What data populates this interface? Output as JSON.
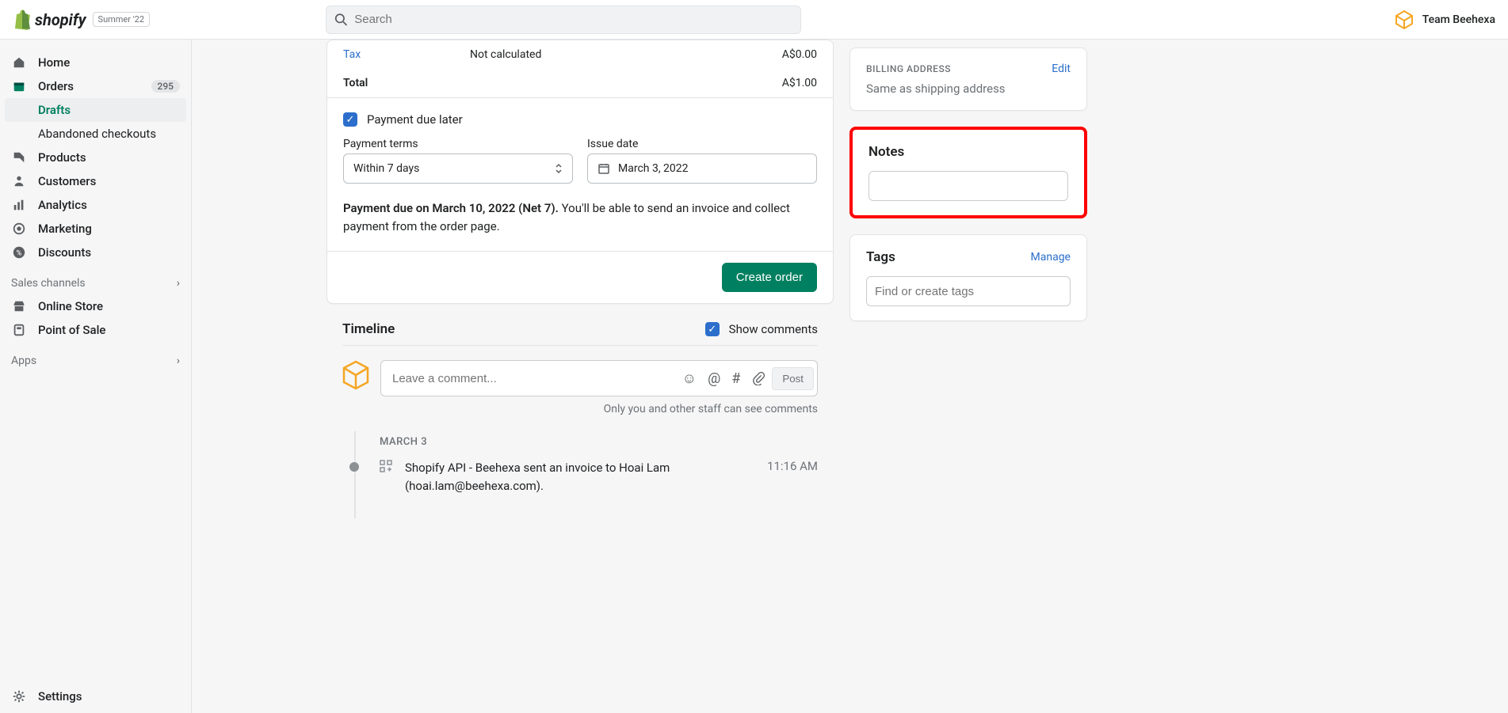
{
  "header": {
    "brand": "shopify",
    "badge": "Summer '22",
    "search_placeholder": "Search",
    "team": "Team Beehexa"
  },
  "sidebar": {
    "home": "Home",
    "orders": "Orders",
    "orders_count": "295",
    "drafts": "Drafts",
    "abandoned": "Abandoned checkouts",
    "products": "Products",
    "customers": "Customers",
    "analytics": "Analytics",
    "marketing": "Marketing",
    "discounts": "Discounts",
    "sales_channels": "Sales channels",
    "online_store": "Online Store",
    "pos": "Point of Sale",
    "apps": "Apps",
    "settings": "Settings"
  },
  "summary": {
    "tax_label": "Tax",
    "tax_mid": "Not calculated",
    "tax_amt": "A$0.00",
    "total_label": "Total",
    "total_amt": "A$1.00"
  },
  "pay": {
    "due_later": "Payment due later",
    "terms_label": "Payment terms",
    "terms_value": "Within 7 days",
    "issue_label": "Issue date",
    "issue_value": "March 3, 2022",
    "note_bold": "Payment due on March 10, 2022 (Net 7).",
    "note_rest": " You'll be able to send an invoice and collect payment from the order page.",
    "create": "Create order"
  },
  "timeline": {
    "title": "Timeline",
    "show_comments": "Show comments",
    "comment_placeholder": "Leave a comment...",
    "post": "Post",
    "staff_note": "Only you and other staff can see comments",
    "date": "MARCH 3",
    "entry_text": "Shopify API - Beehexa sent an invoice to Hoai Lam (hoai.lam@beehexa.com).",
    "entry_time": "11:16 AM"
  },
  "right": {
    "billing_title": "BILLING ADDRESS",
    "edit": "Edit",
    "billing_sub": "Same as shipping address",
    "notes_title": "Notes",
    "tags_title": "Tags",
    "manage": "Manage",
    "tags_placeholder": "Find or create tags"
  }
}
